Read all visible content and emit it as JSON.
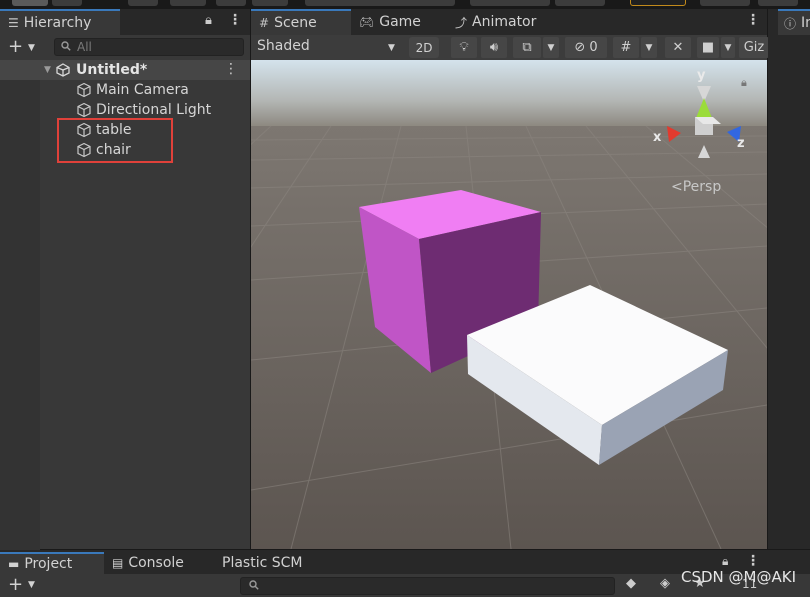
{
  "hierarchy": {
    "tab_label": "Hierarchy",
    "add_label": "+",
    "search_placeholder": "All",
    "scene_name": "Untitled*",
    "items": [
      {
        "label": "Main Camera"
      },
      {
        "label": "Directional Light"
      },
      {
        "label": "table"
      },
      {
        "label": "chair"
      }
    ]
  },
  "scene": {
    "tabs": [
      {
        "label": "Scene",
        "icon": "grid-icon"
      },
      {
        "label": "Game",
        "icon": "gamepad-icon"
      },
      {
        "label": "Animator",
        "icon": "animator-icon"
      }
    ],
    "shading_mode": "Shaded",
    "mode_2d_label": "2D",
    "hidden_count": "0",
    "gizmos_label": "Giz",
    "projection_label": "<Persp",
    "gizmo_axes": {
      "x": "x",
      "y": "y",
      "z": "z"
    }
  },
  "inspector": {
    "tab_label": "In"
  },
  "bottom": {
    "tabs": [
      {
        "label": "Project",
        "icon": "folder-icon"
      },
      {
        "label": "Console",
        "icon": "console-icon"
      },
      {
        "label": "Plastic SCM",
        "icon": ""
      }
    ],
    "add_label": "+",
    "layer_count": "11"
  },
  "watermark": "CSDN @M@AKI",
  "colors": {
    "accent": "#3a79bb",
    "highlight": "#e0413a",
    "magenta_cube": "#c253c9",
    "white_box": "#f4f6fb"
  }
}
